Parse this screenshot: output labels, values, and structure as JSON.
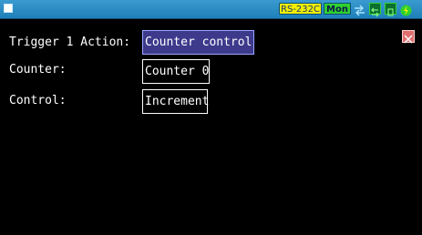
{
  "statusbar": {
    "rs232c_label": "RS-232C",
    "mon_label": "Mon",
    "icons": [
      "menu-square-icon",
      "arrows-icon",
      "swap-icon",
      "card-icon",
      "power-icon"
    ],
    "colors": {
      "bar": "#2b8fc6",
      "rs232c": "#f2ee00",
      "mon": "#2fd12f"
    }
  },
  "form": {
    "trigger_label": "Trigger 1 Action:",
    "trigger_value": "Counter control",
    "counter_label": "Counter:",
    "counter_value": "Counter 0",
    "control_label": "Control:",
    "control_value": "Increment"
  },
  "close_icon": "close-icon",
  "colors": {
    "background": "#000000",
    "selected_field": "#3d3a8c",
    "close": "#e07070"
  }
}
